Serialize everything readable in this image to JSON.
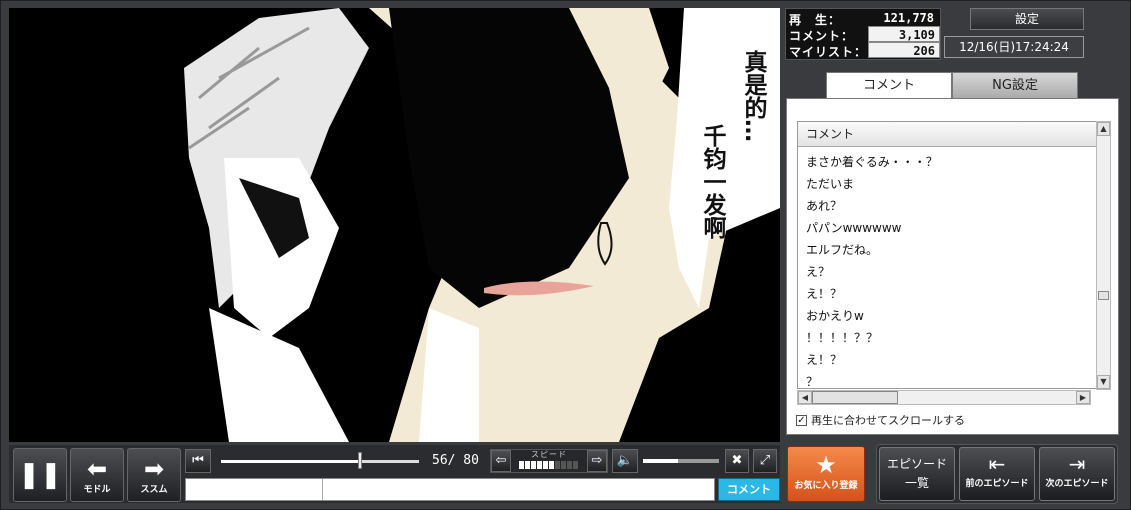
{
  "stats": {
    "views_label": "再　生：",
    "views": "121,778",
    "comments_label": "コメント：",
    "comments": "3,109",
    "mylist_label": "マイリスト：",
    "mylist": "206"
  },
  "header": {
    "settings_label": "設定",
    "datetime": "12/16(日)17:24:24"
  },
  "video": {
    "bubble_line1": "真是的…",
    "bubble_line2": "千钧一发啊"
  },
  "tabs": [
    {
      "label": "コメント",
      "active": true
    },
    {
      "label": "NG設定",
      "active": false
    }
  ],
  "comment_panel": {
    "column_header": "コメント",
    "items": [
      "まさか着ぐるみ・・・？",
      "ただいま",
      "あれ？",
      "パパンwwwwww",
      "エルフだね。",
      "え？",
      "え！？",
      "おかえりw",
      "！！！！？？",
      "え！？",
      "？"
    ],
    "autoscroll_label": "再生に合わせてスクロールする",
    "autoscroll_checked": true
  },
  "controls": {
    "pause_icon": "pause-icon",
    "back_label": "モドル",
    "forward_label": "ススム",
    "current": "56",
    "total": "80",
    "time_text": "56/ 80",
    "speed_label": "スピード",
    "speed_level": 6,
    "speed_steps": 10,
    "volume_level": 0.46,
    "comment_submit_label": "コメント",
    "comment_cmd_value": "",
    "comment_text_value": ""
  },
  "actions": {
    "favorite_label": "お気に入り登録",
    "episode_list_line1": "エピソード",
    "episode_list_line2": "一覧",
    "prev_episode_label": "前のエピソード",
    "next_episode_label": "次のエピソード"
  },
  "colors": {
    "favorite": "#e8692c",
    "comment_submit": "#2ab8e6",
    "frame": "#3a3b3e"
  }
}
